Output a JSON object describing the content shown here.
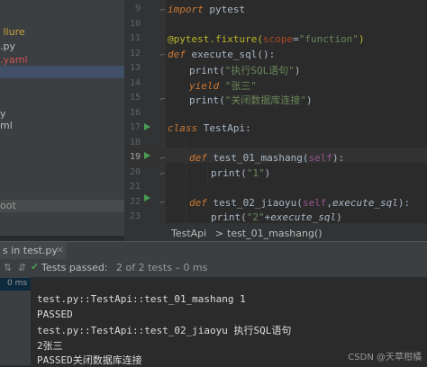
{
  "project_panel": {
    "items": [
      {
        "label": "llure",
        "color": "#c9a43a"
      },
      {
        "label": ".py",
        "color": "#bbbbbb"
      },
      {
        "label": ".yaml",
        "color": "#c75450"
      },
      {
        "label": "y",
        "color": "#bbbbbb"
      },
      {
        "label": "ml",
        "color": "#bbbbbb"
      },
      {
        "label": "oot",
        "color": "#bbbbbb"
      }
    ]
  },
  "editor": {
    "line_numbers": [
      "9",
      "10",
      "11",
      "12",
      "13",
      "14",
      "15",
      "16",
      "17",
      "18",
      "19",
      "20",
      "21",
      "22",
      "23"
    ],
    "lines": {
      "l9": {
        "kw": "import",
        "rest": " pytest"
      },
      "l11": {
        "deco": "@pytest.fixture(",
        "kwarg": "scope",
        "eq": "=",
        "str": "\"function\"",
        "close": ")"
      },
      "l12": {
        "kw": "def",
        "name": " execute_sql():"
      },
      "l13": {
        "fn": "print(",
        "str": "\"执行SQL语句\"",
        "close": ")"
      },
      "l14": {
        "kw": "yield",
        "sp": " ",
        "str": "\"张三\""
      },
      "l15": {
        "fn": "print(",
        "str": "\"关闭数据库连接\"",
        "close": ")"
      },
      "l17": {
        "kw": "class",
        "name": " TestApi:"
      },
      "l19": {
        "kw": "def",
        "name": " test_01_mashang(",
        "self": "self",
        "close": "):"
      },
      "l20": {
        "fn": "print(",
        "str": "\"1\"",
        "close": ")"
      },
      "l22": {
        "kw": "def",
        "name": " test_02_jiaoyu(",
        "self": "self",
        "comma": ",",
        "param": "execute_sql",
        "close": "):"
      },
      "l23": {
        "fn": "print(",
        "str": "\"2\"",
        "plus": "+",
        "param": "execute_sql",
        "close": ")"
      }
    }
  },
  "breadcrumb": {
    "class_name": "TestApi",
    "sep": ">",
    "method_name": "test_01_mashang()"
  },
  "run_window": {
    "tab_label": "s in test.py",
    "tab_close": "×",
    "status_text": "Tests passed:",
    "status_count": "2 of 2 tests – 0 ms",
    "duration": "0 ms",
    "output": [
      "test.py::TestApi::test_01_mashang 1",
      "PASSED",
      "test.py::TestApi::test_02_jiaoyu 执行SQL语句",
      "2张三",
      "PASSED关闭数据库连接"
    ]
  },
  "watermark": "CSDN @天草柑橘",
  "colors": {
    "keyword": "#cc7832",
    "string": "#6a8759",
    "decorator": "#bbb529",
    "self": "#94558d",
    "pass_green": "#499c54"
  }
}
